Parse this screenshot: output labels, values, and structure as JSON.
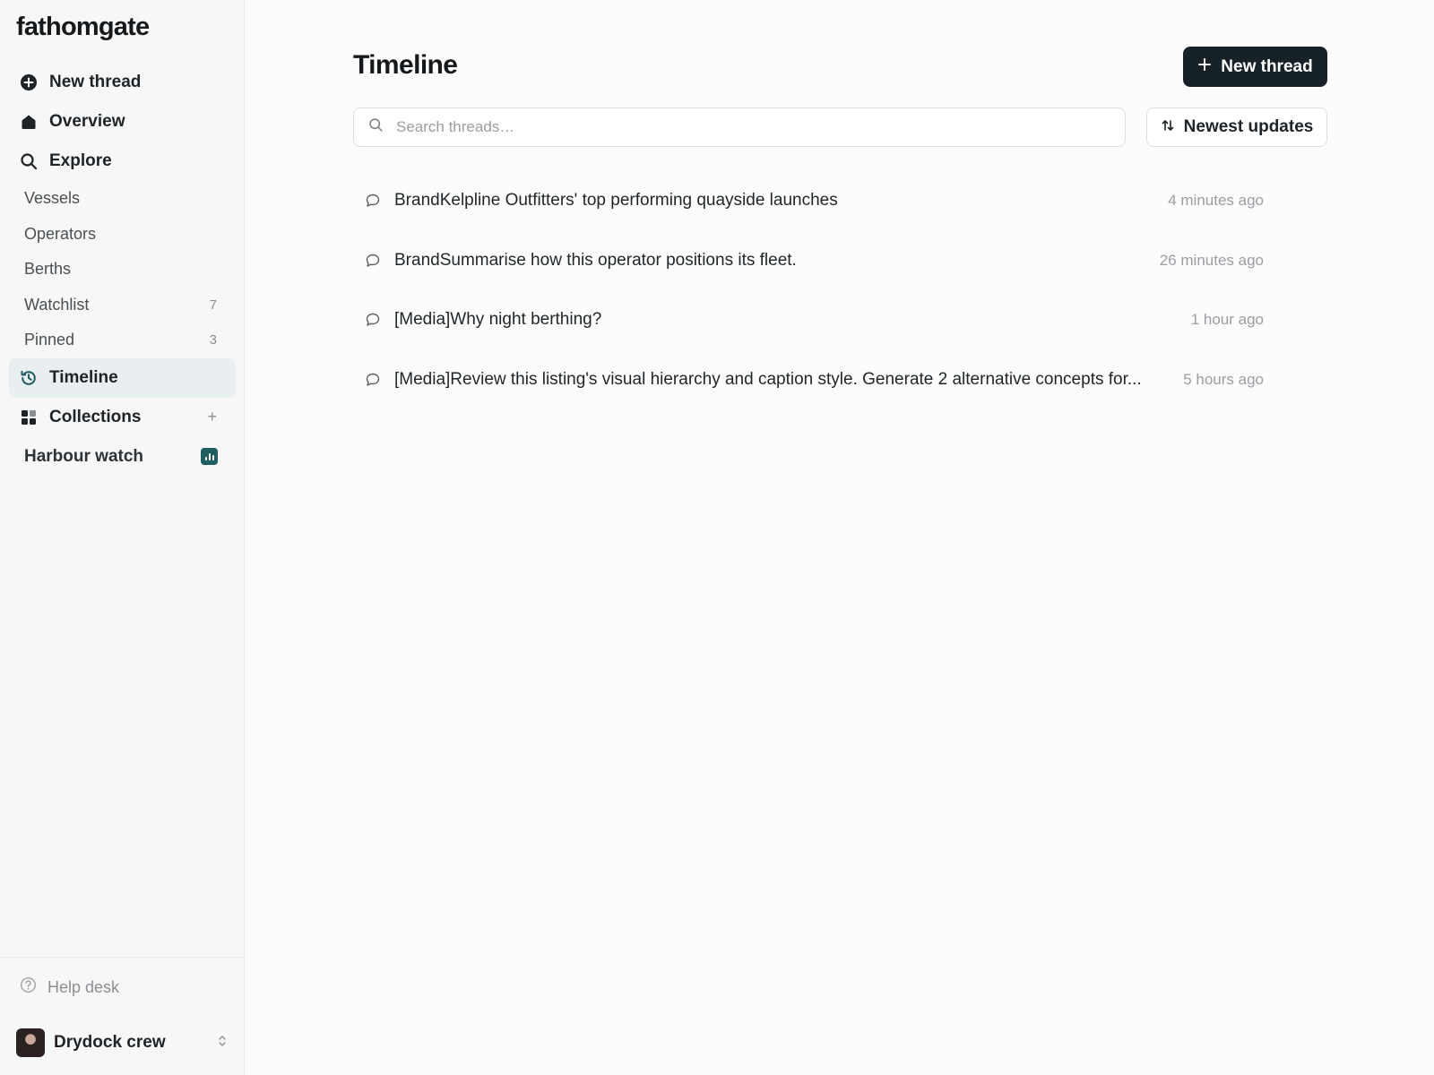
{
  "app": {
    "name": "fathomgate"
  },
  "sidebar": {
    "new_thread": "New thread",
    "overview": "Overview",
    "explore": "Explore",
    "sub_items": [
      {
        "label": "Vessels",
        "count": ""
      },
      {
        "label": "Operators",
        "count": ""
      },
      {
        "label": "Berths",
        "count": ""
      },
      {
        "label": "Watchlist",
        "count": "7"
      },
      {
        "label": "Pinned",
        "count": "3"
      }
    ],
    "timeline": "Timeline",
    "collections": "Collections",
    "collections_add": "+",
    "collection_items": [
      {
        "label": "Harbour watch",
        "icon": "bar-chart-icon",
        "color": "#1f5d63"
      }
    ],
    "help": "Help desk",
    "account": "Drydock crew"
  },
  "main": {
    "title": "Timeline",
    "new_thread_button": "New thread",
    "search_placeholder": "Search threads…",
    "sort_label": "Newest updates",
    "threads": [
      {
        "title": "BrandKelpline Outfitters' top performing quayside launches",
        "time": "4 minutes ago"
      },
      {
        "title": "BrandSummarise how this operator positions its fleet.",
        "time": "26 minutes ago"
      },
      {
        "title": "[Media]Why night berthing?",
        "time": "1 hour ago"
      },
      {
        "title": "[Media]Review this listing's visual hierarchy and caption style. Generate 2 alternative concepts for...",
        "time": "5 hours ago"
      }
    ]
  },
  "colors": {
    "primary_button": "#172228",
    "active_nav_bg": "#e9eef0",
    "accent_teal": "#1f5d63"
  }
}
